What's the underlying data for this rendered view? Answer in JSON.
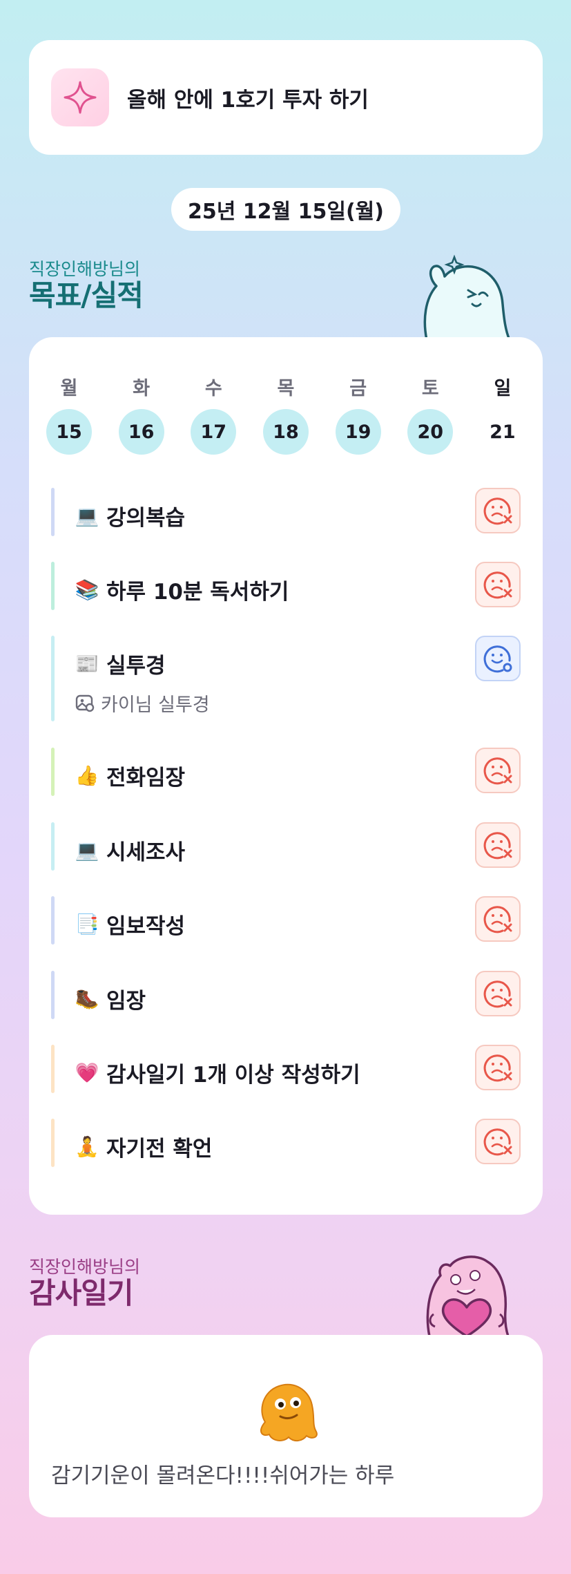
{
  "goal_banner": {
    "icon": "sparkle-icon",
    "text": "올해 안에 1호기 투자 하기"
  },
  "date": "25년 12월 15일(월)",
  "goals_section": {
    "subtitle": "직장인해방님의",
    "title": "목표/실적"
  },
  "week": [
    {
      "name": "월",
      "num": "15",
      "highlight": true
    },
    {
      "name": "화",
      "num": "16",
      "highlight": true
    },
    {
      "name": "수",
      "num": "17",
      "highlight": true
    },
    {
      "name": "목",
      "num": "18",
      "highlight": true
    },
    {
      "name": "금",
      "num": "19",
      "highlight": true
    },
    {
      "name": "토",
      "num": "20",
      "highlight": true
    },
    {
      "name": "일",
      "num": "21",
      "highlight": false
    }
  ],
  "habits": [
    {
      "emoji": "💻",
      "label": "강의복습",
      "status": "fail",
      "bar_color": "#cfd9f5"
    },
    {
      "emoji": "📚",
      "label": "하루 10분 독서하기",
      "status": "fail",
      "bar_color": "#bdeedd"
    },
    {
      "emoji": "📰",
      "label": "실투경",
      "status": "success",
      "bar_color": "#c7eef3",
      "note": "카이님 실투경",
      "note_icon": "image-icon"
    },
    {
      "emoji": "👍",
      "label": "전화임장",
      "status": "fail",
      "bar_color": "#d5f2b8"
    },
    {
      "emoji": "💻",
      "label": "시세조사",
      "status": "fail",
      "bar_color": "#c7eef3"
    },
    {
      "emoji": "📑",
      "label": "임보작성",
      "status": "fail",
      "bar_color": "#cfd9f5"
    },
    {
      "emoji": "🥾",
      "label": "임장",
      "status": "fail",
      "bar_color": "#cfd9f5"
    },
    {
      "emoji": "💗",
      "label": "감사일기 1개 이상 작성하기",
      "status": "fail",
      "bar_color": "#fde3c4"
    },
    {
      "emoji": "🧘",
      "label": "자기전 확언",
      "status": "fail",
      "bar_color": "#fde3c4"
    }
  ],
  "diary_section": {
    "subtitle": "직장인해방님의",
    "title": "감사일기"
  },
  "diary": {
    "mood_icon": "melting-blob-icon",
    "text": "감기기운이 몰려온다!!!!쉬어가는 하루"
  },
  "colors": {
    "fail": "#e8574a",
    "success": "#3f6fd8",
    "accent_teal": "#156f73",
    "accent_pink": "#7e2a6c"
  }
}
